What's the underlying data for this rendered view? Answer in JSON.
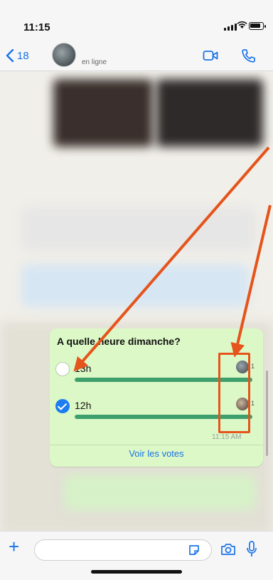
{
  "status_bar": {
    "time": "11:15"
  },
  "header": {
    "back_count": "18",
    "status": "en ligne",
    "icons": [
      "chevron-left-icon",
      "video-camera-icon",
      "phone-icon"
    ]
  },
  "poll": {
    "question": "A quelle heure dimanche?",
    "options": [
      {
        "label": "13h",
        "votes": "1",
        "selected": false,
        "fill_fraction": 1.0
      },
      {
        "label": "12h",
        "votes": "1",
        "selected": true,
        "fill_fraction": 1.0
      }
    ],
    "timestamp": "11:15 AM",
    "view_votes_label": "Voir les votes"
  },
  "colors": {
    "accent_blue": "#1a73e8",
    "poll_bubble": "#dcf8c6",
    "vote_bar": "#3da06c",
    "annotation_orange": "#e5541b"
  },
  "input_bar": {
    "icons": [
      "plus-icon",
      "sticker-icon",
      "camera-icon",
      "microphone-icon"
    ]
  }
}
